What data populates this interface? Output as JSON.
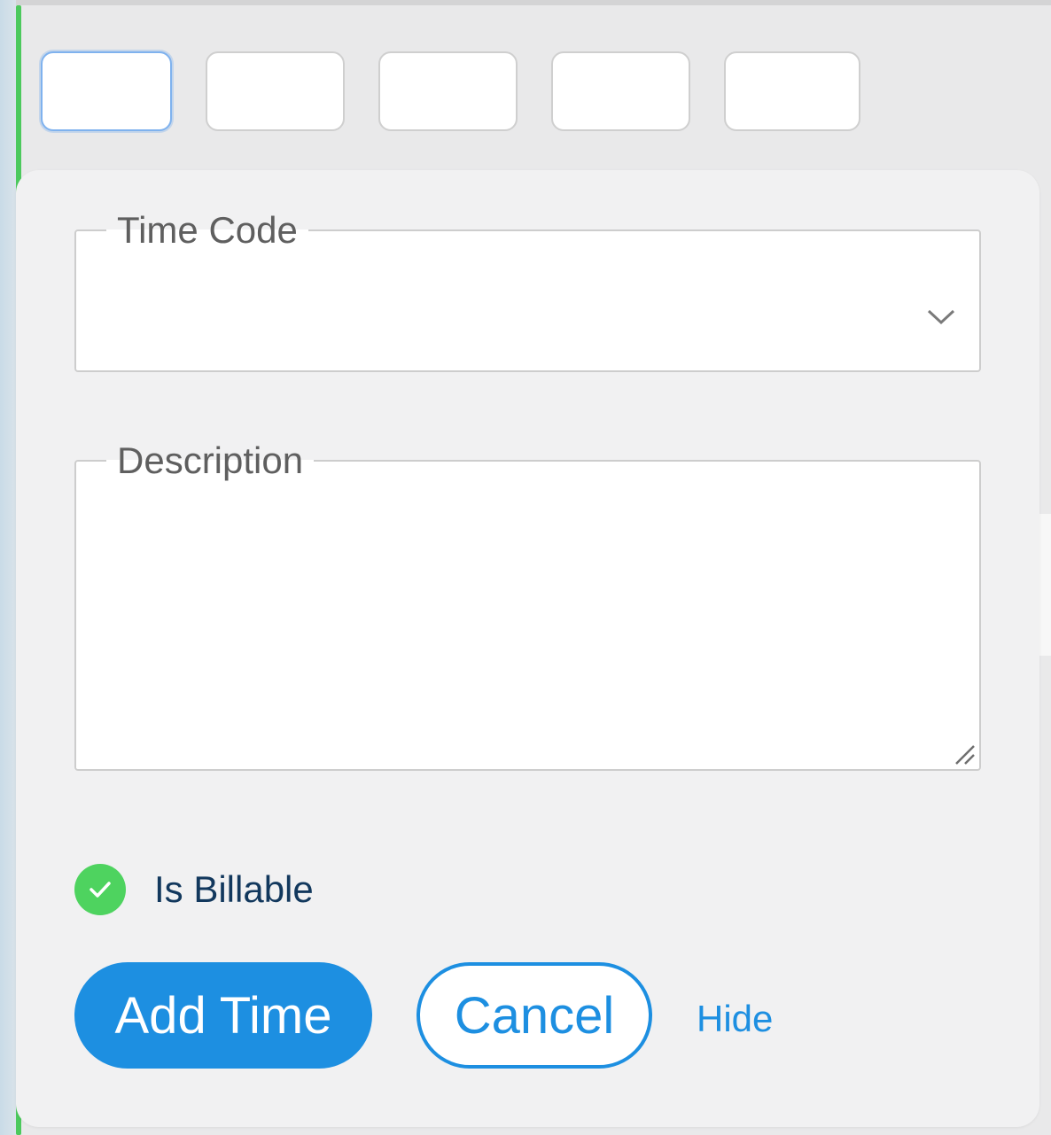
{
  "colors": {
    "accent_blue": "#1d8fe1",
    "billable_green": "#4ed35f",
    "row_accent_green": "#4cc95d",
    "label_navy": "#12385d"
  },
  "form": {
    "time_code": {
      "label": "Time Code",
      "value": "",
      "icon": "chevron-down-icon"
    },
    "description": {
      "label": "Description",
      "value": ""
    },
    "is_billable": {
      "label": "Is Billable",
      "checked": true,
      "icon": "check-icon"
    },
    "buttons": {
      "add_time": "Add Time",
      "cancel": "Cancel",
      "hide": "Hide"
    }
  },
  "duration_inputs": [
    "",
    "",
    "",
    "",
    ""
  ]
}
